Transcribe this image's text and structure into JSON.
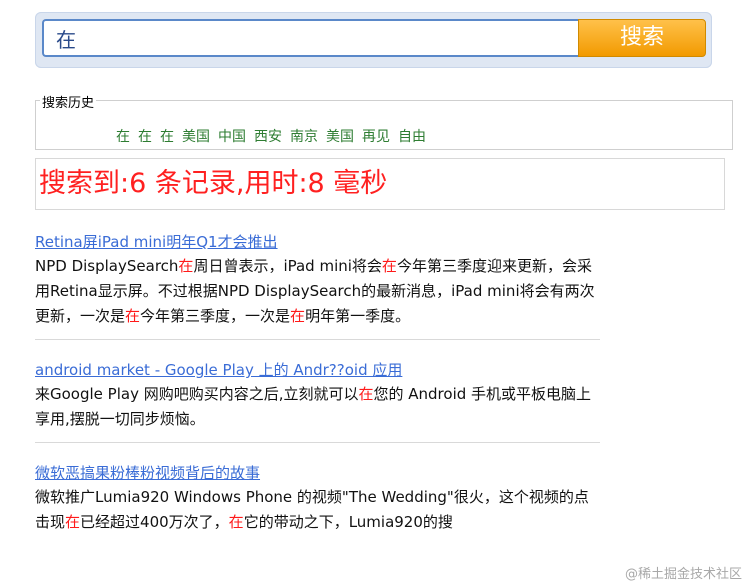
{
  "search": {
    "value": "在",
    "button_label": "搜索"
  },
  "history": {
    "label": "搜索历史",
    "items": [
      "在",
      "在",
      "在",
      "美国",
      "中国",
      "西安",
      "南京",
      "美国",
      "再见",
      "自由"
    ]
  },
  "summary": "搜索到:6 条记录,用时:8 毫秒",
  "results": [
    {
      "title": "Retina屏iPad mini明年Q1才会推出",
      "segments": [
        {
          "t": "NPD DisplaySearch",
          "hl": false
        },
        {
          "t": "在",
          "hl": true
        },
        {
          "t": "周日曾表示，iPad mini将会",
          "hl": false
        },
        {
          "t": "在",
          "hl": true
        },
        {
          "t": "今年第三季度迎来更新，会采用Retina显示屏。不过根据NPD DisplaySearch的最新消息，iPad mini将会有两次更新，一次是",
          "hl": false
        },
        {
          "t": "在",
          "hl": true
        },
        {
          "t": "今年第三季度，一次是",
          "hl": false
        },
        {
          "t": "在",
          "hl": true
        },
        {
          "t": "明年第一季度。",
          "hl": false
        }
      ]
    },
    {
      "title": "android market - Google Play 上的 Andr??oid 应用",
      "segments": [
        {
          "t": "来Google Play 网购吧购买内容之后,立刻就可以",
          "hl": false
        },
        {
          "t": "在",
          "hl": true
        },
        {
          "t": "您的 Android 手机或平板电脑上享用,摆脱一切同步烦恼。",
          "hl": false
        }
      ]
    },
    {
      "title": "微软恶搞果粉棒粉视频背后的故事",
      "segments": [
        {
          "t": "微软推广Lumia920 Windows Phone 的视频\"The Wedding\"很火，这个视频的点击现",
          "hl": false
        },
        {
          "t": "在",
          "hl": true
        },
        {
          "t": "已经超过400万次了，",
          "hl": false
        },
        {
          "t": "在",
          "hl": true
        },
        {
          "t": "它的带动之下，Lumia920的搜",
          "hl": false
        }
      ]
    }
  ],
  "watermark": "@稀土掘金技术社区"
}
